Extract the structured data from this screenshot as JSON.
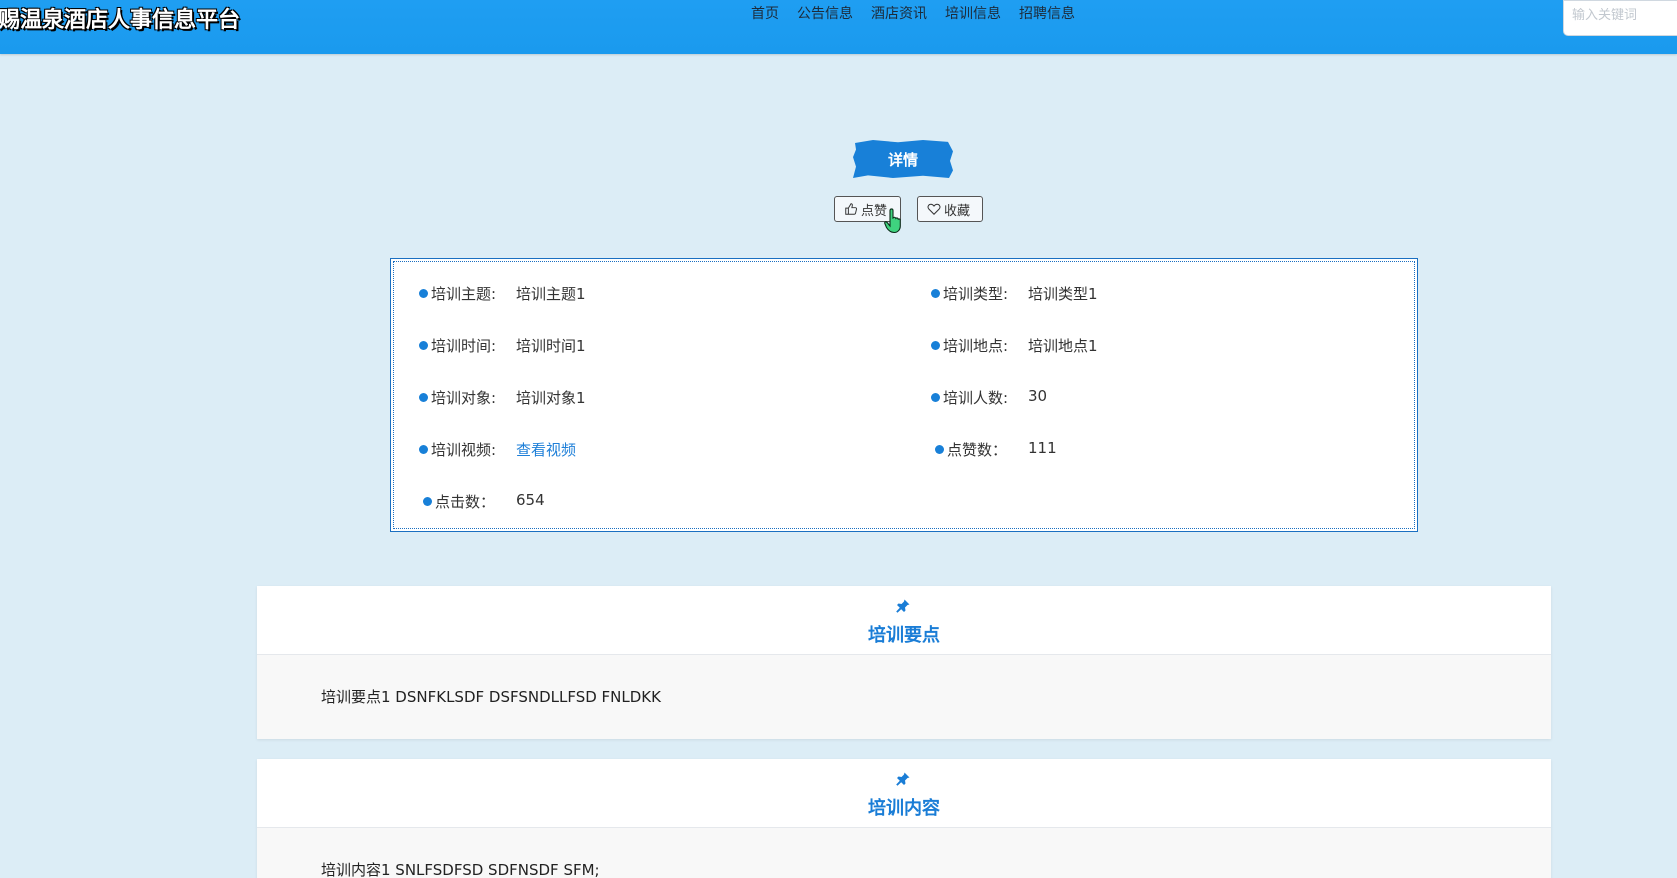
{
  "header": {
    "site_title": "赐温泉酒店人事信息平台",
    "nav": [
      "首页",
      "公告信息",
      "酒店资讯",
      "培训信息",
      "招聘信息"
    ],
    "search_placeholder": "输入关键词"
  },
  "detail": {
    "button_label": "详情",
    "like_label": "点赞",
    "favorite_label": "收藏"
  },
  "info": {
    "rows": [
      {
        "label": "培训主题:",
        "value": "培训主题1"
      },
      {
        "label": "培训类型:",
        "value": "培训类型1"
      },
      {
        "label": "培训时间:",
        "value": "培训时间1"
      },
      {
        "label": "培训地点:",
        "value": "培训地点1"
      },
      {
        "label": "培训对象:",
        "value": "培训对象1"
      },
      {
        "label": "培训人数:",
        "value": "30"
      },
      {
        "label": "培训视频:",
        "value": "查看视频"
      },
      {
        "label": "点赞数：",
        "value": "111"
      },
      {
        "label": "点击数：",
        "value": "654"
      }
    ]
  },
  "sections": [
    {
      "title": "培训要点",
      "content": "培训要点1 DSNFKLSDF DSFSNDLLFSD FNLDKK"
    },
    {
      "title": "培训内容",
      "content": "培训内容1 SNLFSDFSD SDFNSDF SFM;"
    }
  ],
  "colors": {
    "header_bg": "#1f9ef2",
    "page_bg": "#dcedf6",
    "accent": "#1880d8"
  }
}
